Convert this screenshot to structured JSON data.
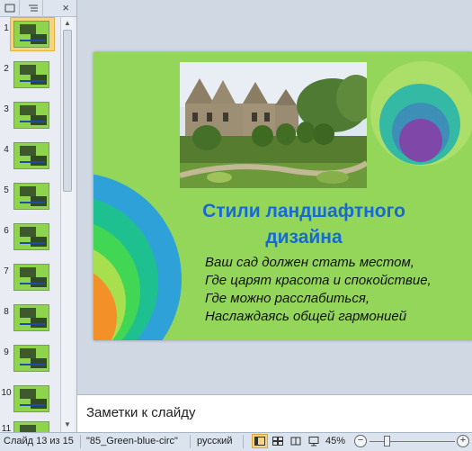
{
  "left_pane": {
    "tab_slides_icon": "slides-icon",
    "tab_outline_icon": "outline-icon",
    "close_glyph": "×",
    "thumbnails": [
      {
        "number": "1",
        "selected": true
      },
      {
        "number": "2",
        "selected": false
      },
      {
        "number": "3",
        "selected": false
      },
      {
        "number": "4",
        "selected": false
      },
      {
        "number": "5",
        "selected": false
      },
      {
        "number": "6",
        "selected": false
      },
      {
        "number": "7",
        "selected": false
      },
      {
        "number": "8",
        "selected": false
      },
      {
        "number": "9",
        "selected": false
      },
      {
        "number": "10",
        "selected": false
      },
      {
        "number": "11",
        "selected": false
      }
    ]
  },
  "slide": {
    "background_color": "#93d65a",
    "title_lines": [
      "Стили ландшафтного",
      "дизайна"
    ],
    "body_lines": [
      "Ваш сад должен стать местом,",
      "Где царят красота и спокойствие,",
      "Где можно расслабиться,",
      "Наслаждаясь общей гармонией"
    ],
    "title_color": "#1769d4",
    "photo_icon": "garden-house-photo"
  },
  "notes": {
    "placeholder": "Заметки к слайду"
  },
  "status_bar": {
    "slide_indicator": "Слайд 13 из 15",
    "theme": "\"85_Green-blue-circ\"",
    "language": "русский",
    "zoom": "45%",
    "zoom_minus": "−",
    "zoom_plus": "+"
  }
}
